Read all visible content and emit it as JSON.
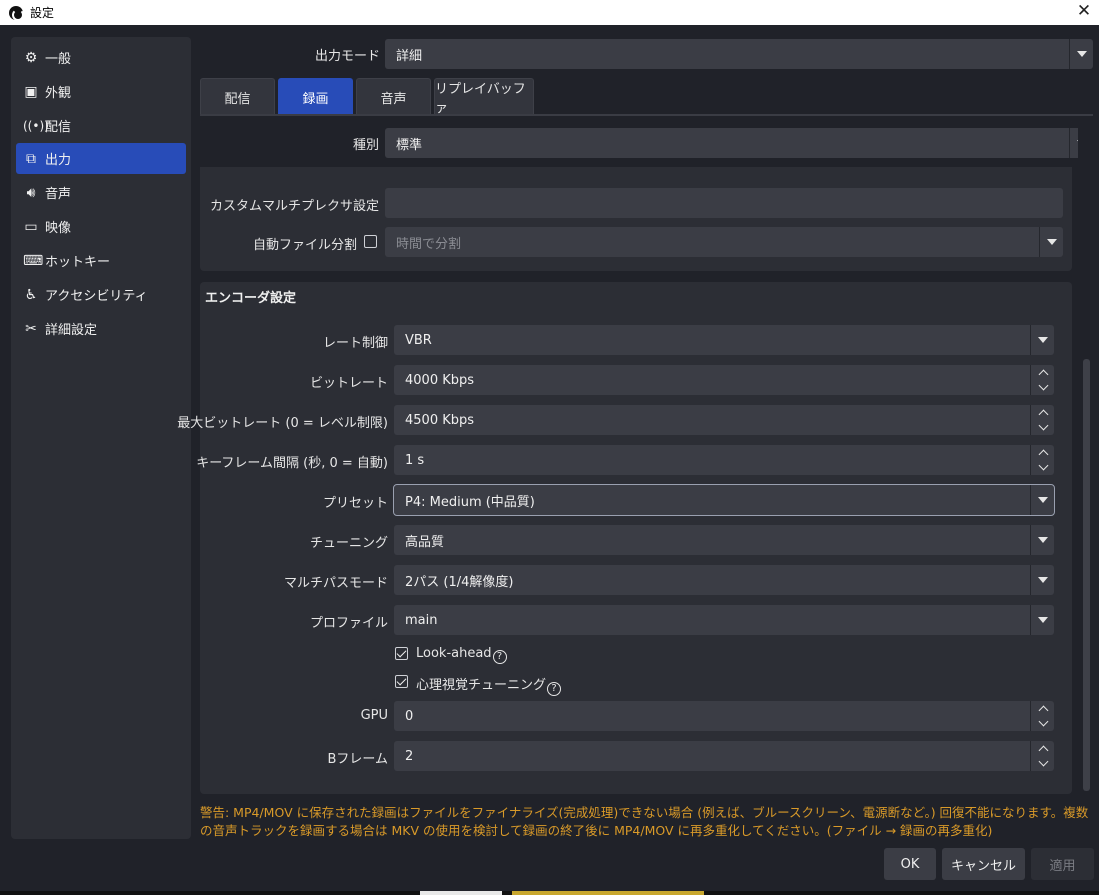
{
  "window": {
    "title": "設定"
  },
  "sidebar": {
    "items": [
      {
        "label": "一般",
        "icon": "gear-icon"
      },
      {
        "label": "外観",
        "icon": "appearance-icon"
      },
      {
        "label": "配信",
        "icon": "broadcast-icon"
      },
      {
        "label": "出力",
        "icon": "output-icon",
        "active": true
      },
      {
        "label": "音声",
        "icon": "speaker-icon"
      },
      {
        "label": "映像",
        "icon": "monitor-icon"
      },
      {
        "label": "ホットキー",
        "icon": "keyboard-icon"
      },
      {
        "label": "アクセシビリティ",
        "icon": "accessibility-icon"
      },
      {
        "label": "詳細設定",
        "icon": "tools-icon"
      }
    ]
  },
  "output_mode": {
    "label": "出力モード",
    "value": "詳細"
  },
  "tabs": [
    {
      "label": "配信"
    },
    {
      "label": "録画",
      "active": true
    },
    {
      "label": "音声"
    },
    {
      "label": "リプレイバッファ"
    }
  ],
  "recording": {
    "type_label": "種別",
    "type_value": "標準",
    "mux_label": "カスタムマルチプレクサ設定",
    "mux_value": "",
    "split_label": "自動ファイル分割",
    "split_checked": false,
    "split_value": "時間で分割"
  },
  "encoder": {
    "title": "エンコーダ設定",
    "rate_control": {
      "label": "レート制御",
      "value": "VBR"
    },
    "bitrate": {
      "label": "ビットレート",
      "value": "4000 Kbps"
    },
    "max_bitrate": {
      "label": "最大ビットレート (0 = レベル制限)",
      "value": "4500 Kbps"
    },
    "keyframe": {
      "label": "キーフレーム間隔 (秒, 0 = 自動)",
      "value": "1 s"
    },
    "preset": {
      "label": "プリセット",
      "value": "P4: Medium (中品質)"
    },
    "tuning": {
      "label": "チューニング",
      "value": "高品質"
    },
    "multipass": {
      "label": "マルチパスモード",
      "value": "2パス (1/4解像度)"
    },
    "profile": {
      "label": "プロファイル",
      "value": "main"
    },
    "lookahead": {
      "label": "Look-ahead",
      "checked": true
    },
    "psycho": {
      "label": "心理視覚チューニング",
      "checked": true
    },
    "gpu": {
      "label": "GPU",
      "value": "0"
    },
    "bframes": {
      "label": "Bフレーム",
      "value": "2"
    }
  },
  "warning": "警告: MP4/MOV に保存された録画はファイルをファイナライズ(完成処理)できない場合 (例えば、ブルースクリーン、電源断など。) 回復不能になります。複数の音声トラックを録画する場合は MKV の使用を検討して録画の終了後に MP4/MOV に再多重化してください。(ファイル → 録画の再多重化)",
  "buttons": {
    "ok": "OK",
    "cancel": "キャンセル",
    "apply": "適用"
  },
  "colors": {
    "accent": "#284cb8",
    "warning": "#d99a29",
    "background": "#202229",
    "panel": "#2c2e35"
  }
}
